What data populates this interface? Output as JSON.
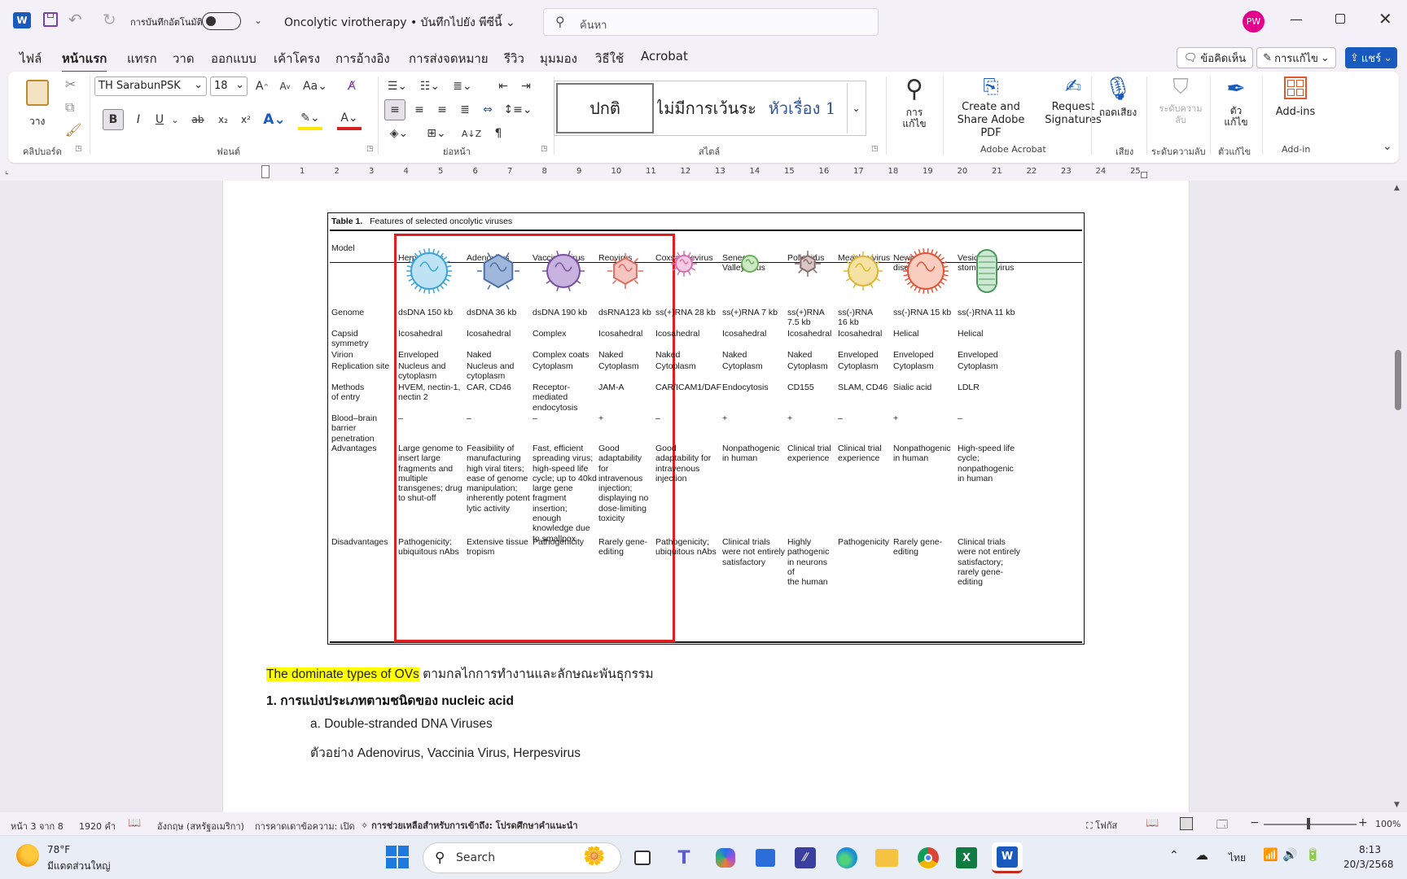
{
  "titlebar": {
    "autosave_label": "การบันทึกอัตโนมัติ",
    "doc_title": "Oncolytic virotherapy • บันทึกไปยัง พีซีนี้",
    "search_placeholder": "ค้นหา",
    "avatar_initials": "PW"
  },
  "menu": [
    "ไฟล์",
    "หน้าแรก",
    "แทรก",
    "วาด",
    "ออกแบบ",
    "เค้าโครง",
    "การอ้างอิง",
    "การส่งจดหมาย",
    "รีวิว",
    "มุมมอง",
    "วิธีใช้",
    "Acrobat"
  ],
  "menu_right": {
    "comments": "ข้อคิดเห็น",
    "editing": "การแก้ไข",
    "share": "แชร์"
  },
  "ribbon": {
    "paste": "วาง",
    "clipboard": "คลิปบอร์ด",
    "font_name": "TH SarabunPSK",
    "font_size": "18",
    "font_group": "ฟอนต์",
    "paragraph_group": "ย่อหน้า",
    "style_normal": "ปกติ",
    "style_nospacing": "ไม่มีการเว้นระ",
    "style_heading1": "หัวเรื่อง 1",
    "styles_group": "สไตล์",
    "find_label": "การแก้ไข",
    "create_pdf": "Create and Share Adobe PDF",
    "request_sig": "Request Signatures",
    "acrobat_group": "Adobe Acrobat",
    "dictate": "ถอดเสียง",
    "voice_group": "เสียง",
    "sensitivity": "ระดับความลับ",
    "sensitivity_group": "ระดับความลับ",
    "editor": "ตัวแก้ไข",
    "editor_group": "ตัวแก้ไข",
    "addins": "Add-ins",
    "addins_group": "Add-in",
    "bold": "B",
    "italic": "I",
    "underline": "U",
    "strike": "ab",
    "sub": "x₂",
    "sup": "x²",
    "aa": "Aa"
  },
  "ruler_numbers": [
    "1",
    "2",
    "3",
    "4",
    "5",
    "6",
    "7",
    "8",
    "9",
    "10",
    "11",
    "12",
    "13",
    "14",
    "15",
    "16",
    "17",
    "18",
    "19",
    "20",
    "21",
    "22",
    "23",
    "24",
    "25"
  ],
  "table": {
    "caption_bold": "Table 1.",
    "caption": "Features of selected oncolytic viruses",
    "columns": [
      "Herpesvirus",
      "Adenovirus",
      "Vaccinia virus",
      "Reovirus",
      "Coxsackievirus",
      "Seneca\nValley virus",
      "Poliovirus",
      "Measles virus",
      "Newcastle\ndisease virus",
      "Vesicular\nstomatitis virus"
    ],
    "row_labels": [
      "Model",
      "Genome",
      "Capsid\nsymmetry",
      "Virion",
      "Replication site",
      "Methods\nof entry",
      "Blood–brain\nbarrier\npenetration",
      "Advantages",
      "Disadvantages"
    ],
    "genome": [
      "dsDNA 150 kb",
      "dsDNA 36 kb",
      "dsDNA 190 kb",
      "dsRNA123 kb",
      "ss(+)RNA 28 kb",
      "ss(+)RNA 7 kb",
      "ss(+)RNA\n7.5 kb",
      "ss(-)RNA\n16 kb",
      "ss(-)RNA 15 kb",
      "ss(-)RNA 11 kb"
    ],
    "capsid": [
      "Icosahedral",
      "Icosahedral",
      "Complex",
      "Icosahedral",
      "Icosahedral",
      "Icosahedral",
      "Icosahedral",
      "Icosahedral",
      "Helical",
      "Helical"
    ],
    "virion": [
      "Enveloped",
      "Naked",
      "Complex coats",
      "Naked",
      "Naked",
      "Naked",
      "Naked",
      "Enveloped",
      "Enveloped",
      "Enveloped"
    ],
    "replication": [
      "Nucleus and\ncytoplasm",
      "Nucleus and\ncytoplasm",
      "Cytoplasm",
      "Cytoplasm",
      "Cytoplasm",
      "Cytoplasm",
      "Cytoplasm",
      "Cytoplasm",
      "Cytoplasm",
      "Cytoplasm"
    ],
    "entry": [
      "HVEM, nectin-1,\nnectin 2",
      "CAR, CD46",
      "Receptor-\nmediated\nendocytosis",
      "JAM-A",
      "CAR/ICAM1/DAF",
      "Endocytosis",
      "CD155",
      "SLAM, CD46",
      "Sialic acid",
      "LDLR"
    ],
    "bbb": [
      "–",
      "–",
      "–",
      "+",
      "–",
      "+",
      "+",
      "–",
      "+",
      "–"
    ],
    "advantages": [
      "Large genome to\ninsert large\nfragments and\nmultiple\ntransgenes; drug\nto shut-off",
      "Feasibility of\nmanufacturing\nhigh viral titers;\nease of genome\nmanipulation;\ninherently potent\nlytic activity",
      "Fast, efficient\nspreading virus;\nhigh-speed life\ncycle; up to 40kd\nlarge gene\nfragment\ninsertion;\nenough\nknowledge due\nto smallpox",
      "Good\nadaptability\nfor\nintravenous\ninjection;\ndisplaying no\ndose-limiting\ntoxicity",
      "Good\nadaptability for\nintravenous\ninjection",
      "Nonpathogenic\nin human",
      "Clinical trial\nexperience",
      "Clinical trial\nexperience",
      "Nonpathogenic\nin human",
      "High-speed life\ncycle;\nnonpathogenic\nin human"
    ],
    "disadvantages": [
      "Pathogenicity;\nubiquitous nAbs",
      "Extensive tissue\ntropism",
      "Pathogenicity",
      "Rarely gene-\nediting",
      "Pathogenicity;\nubiquitous nAbs",
      "Clinical trials\nwere not entirely\nsatisfactory",
      "Highly\npathogenic\nin neurons\nof\nthe human",
      "Pathogenicity",
      "Rarely gene-\nediting",
      "Clinical trials\nwere not entirely\nsatisfactory;\nrarely gene-\nediting"
    ]
  },
  "body": {
    "highlight": "The dominate types of OVs",
    "line1_rest": " ตามกลไกการทำงานและลักษณะพันธุกรรม",
    "line2": "1. การแบ่งประเภทตามชนิดของ nucleic acid",
    "line3": "a. Double-stranded DNA Viruses",
    "line4": "ตัวอย่าง Adenovirus, Vaccinia Virus, Herpesvirus"
  },
  "status": {
    "page": "หน้า 3 จาก 8",
    "words": "1920 คำ",
    "language": "อังกฤษ (สหรัฐอเมริกา)",
    "predict": "การคาดเดาข้อความ: เปิด",
    "accessibility": "การช่วยเหลือสำหรับการเข้าถึง: โปรดศึกษาคำแนะนำ",
    "focus": "โฟกัส",
    "zoom": "100%"
  },
  "taskbar": {
    "temp": "78°F",
    "weather": "มีแดดส่วนใหญ่",
    "search": "Search",
    "lang": "ไทย",
    "time": "8:13",
    "date": "20/3/2568"
  },
  "colors": {
    "accent": "#185abd",
    "highlight": "#ffff00",
    "red_box": "#e02020",
    "avatar": "#e3008c"
  }
}
